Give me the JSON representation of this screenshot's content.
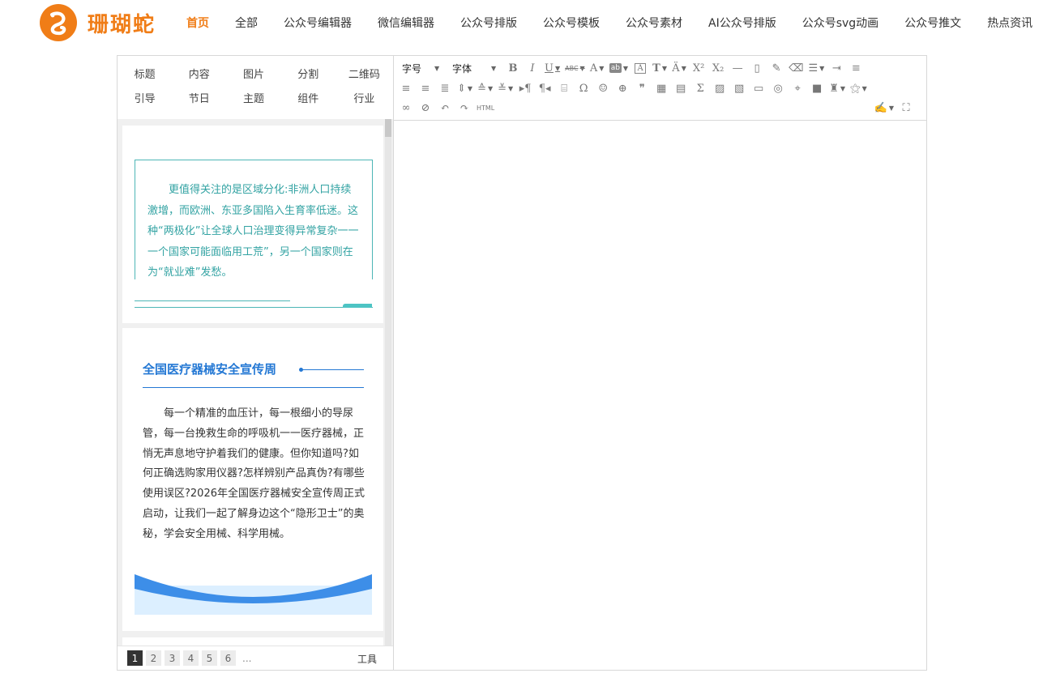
{
  "brand": {
    "name": "珊瑚蛇",
    "color": "#f07d17"
  },
  "nav": {
    "items": [
      {
        "label": "首页",
        "active": true
      },
      {
        "label": "全部"
      },
      {
        "label": "公众号编辑器"
      },
      {
        "label": "微信编辑器"
      },
      {
        "label": "公众号排版"
      },
      {
        "label": "公众号模板"
      },
      {
        "label": "公众号素材"
      },
      {
        "label": "AI公众号排版"
      },
      {
        "label": "公众号svg动画"
      },
      {
        "label": "公众号推文"
      },
      {
        "label": "热点资讯"
      }
    ]
  },
  "categories": {
    "row1": [
      "标题",
      "内容",
      "图片",
      "分割",
      "二维码"
    ],
    "row2": [
      "引导",
      "节日",
      "主题",
      "组件",
      "行业"
    ]
  },
  "templates": {
    "card1": {
      "text": "更值得关注的是区域分化:非洲人口持续激增，而欧洲、东亚多国陷入生育率低迷。这种“两极化”让全球人口治理变得异常复杂一一一个国家可能面临用工荒”，另一个国家则在为“就业难”发愁。",
      "accent": "#33a3a3"
    },
    "card2": {
      "title": "全国医疗器械安全宣传周",
      "text": "每一个精准的血压计，每一根细小的导尿管，每一台挽救生命的呼吸机一一医疗器械，正悄无声息地守护着我们的健康。但你知道吗?如何正确选购家用仪器?怎样辨别产品真伪?有哪些使用误区?2026年全国医疗器械安全宣传周正式启动，让我们一起了解身边这个“隐形卫士”的奥秘，学会安全用械、科学用械。",
      "accent": "#2478d4"
    }
  },
  "pager": {
    "pages": [
      "1",
      "2",
      "3",
      "4",
      "5",
      "6"
    ],
    "current": "1",
    "ellipsis": "...",
    "tools_label": "工具"
  },
  "toolbar": {
    "font_size_label": "字号",
    "font_family_label": "字体",
    "html_label": "HTML"
  }
}
